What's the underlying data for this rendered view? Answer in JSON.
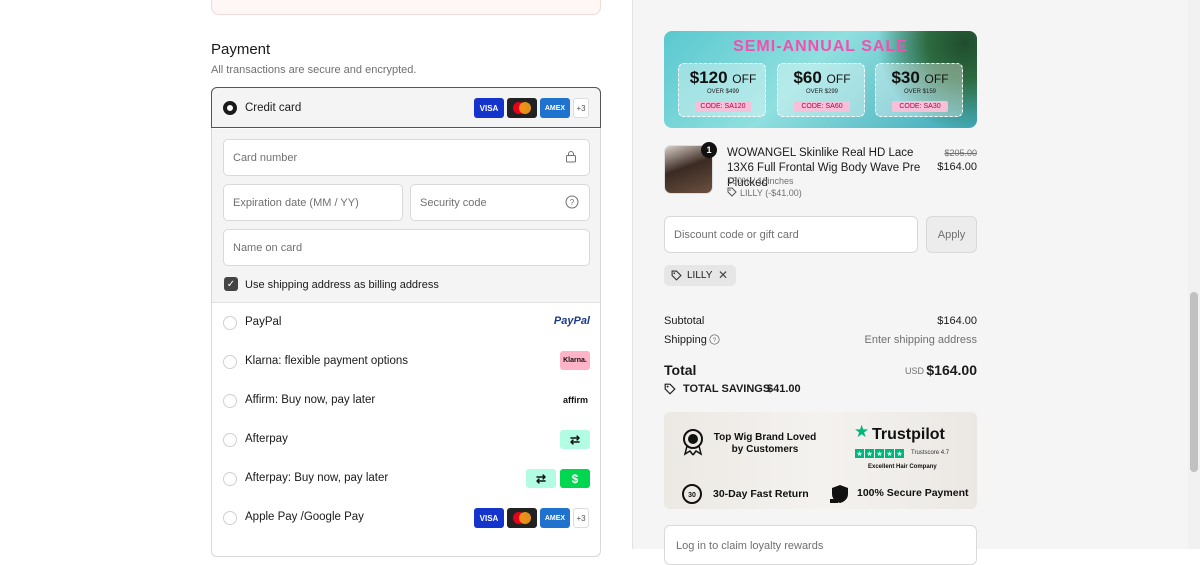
{
  "payment": {
    "title": "Payment",
    "subtitle": "All transactions are secure and encrypted.",
    "credit_card_label": "Credit card",
    "more_cards": "+3",
    "card_number_placeholder": "Card number",
    "expiration_placeholder": "Expiration date (MM / YY)",
    "security_placeholder": "Security code",
    "name_placeholder": "Name on card",
    "billing_label": "Use shipping address as billing address",
    "methods": [
      {
        "label": "PayPal",
        "badge": "PayPal"
      },
      {
        "label": "Klarna: flexible payment options",
        "badge": "Klarna."
      },
      {
        "label": "Affirm: Buy now, pay later",
        "badge": "affirm"
      },
      {
        "label": "Afterpay",
        "badge": "⇄"
      },
      {
        "label": "Afterpay: Buy now, pay later",
        "badge": "⇄",
        "badge2": "$"
      },
      {
        "label": "Apple Pay /Google Pay",
        "more": "+3"
      }
    ],
    "card_brands": {
      "visa": "VISA",
      "amex": "AMEX"
    }
  },
  "banner": {
    "title": "SEMI-ANNUAL SALE",
    "coupons": [
      {
        "amount": "$120",
        "off": "OFF",
        "over": "OVER $499",
        "code": "CODE: SA120"
      },
      {
        "amount": "$60",
        "off": "OFF",
        "over": "OVER $299",
        "code": "CODE: SA60"
      },
      {
        "amount": "$30",
        "off": "OFF",
        "over": "OVER $159",
        "code": "CODE: SA30"
      }
    ]
  },
  "product": {
    "quantity": "1",
    "title": "WOWANGEL Skinlike Real HD Lace 13X6 Full Frontal Wig Body Wave Pre Plucked",
    "variant": "180% / 16inches",
    "discount": "LILLY (-$41.00)",
    "original_price": "$205.00",
    "price": "$164.00"
  },
  "discount": {
    "placeholder": "Discount code or gift card",
    "apply_label": "Apply",
    "applied_code": "LILLY"
  },
  "summary": {
    "subtotal_label": "Subtotal",
    "subtotal_value": "$164.00",
    "shipping_label": "Shipping",
    "shipping_value": "Enter shipping address",
    "total_label": "Total",
    "currency": "USD",
    "total_value": "$164.00",
    "savings_label": "TOTAL SAVINGS",
    "savings_value": "$41.00"
  },
  "trust": {
    "brand_line1": "Top Wig Brand Loved",
    "brand_line2": "by Customers",
    "trustpilot": "Trustpilot",
    "trustscore": "Trustscore 4.7",
    "excellent": "Excellent Hair Company",
    "return_label": "30-Day Fast Return",
    "secure_label": "100% Secure Payment"
  },
  "loyalty": {
    "text": "Log in to claim loyalty rewards"
  }
}
